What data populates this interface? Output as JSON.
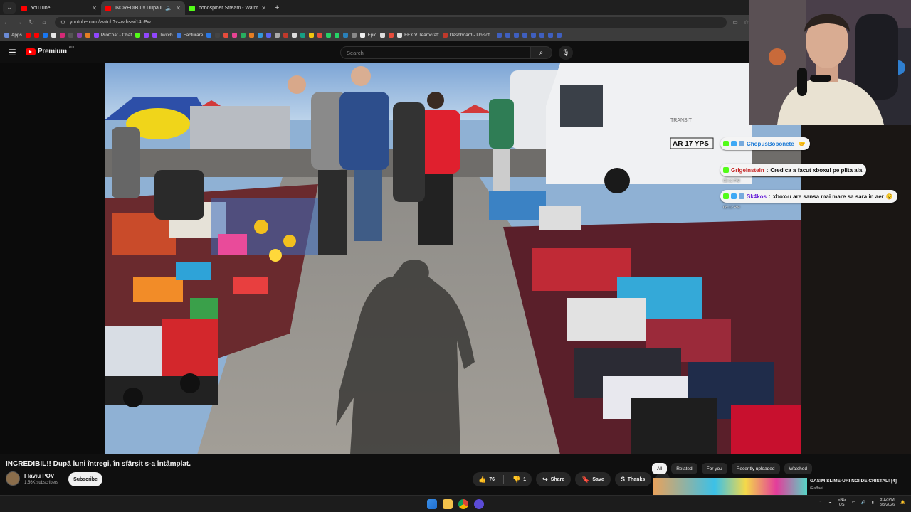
{
  "browser": {
    "tabs": [
      {
        "title": "YouTube",
        "favicon_color": "#ff0000",
        "active": false
      },
      {
        "title": "INCREDIBIL!! După luni întreg",
        "favicon_color": "#ff0000",
        "active": true
      },
      {
        "title": "bobospider Stream - Watch Liv",
        "favicon_color": "#53fc18",
        "active": false
      }
    ],
    "new_tab_icon": "+",
    "url": "youtube.com/watch?v=wthswi14cPw",
    "bookmarks": [
      "Apps",
      "ProChat - Chat",
      "Twitch",
      "Facturare",
      "Epic",
      "FFXIV Teamcraft",
      "Dashboard - Ubisof..."
    ]
  },
  "youtube": {
    "logo_text": "Premium",
    "country_code": "RO",
    "search_placeholder": "Search",
    "video_title": "INCREDIBIL!! După luni întregi, în sfârșit s-a întâmplat.",
    "channel_name": "Flaviu POV",
    "subscribers": "1.56K subscribers",
    "subscribe_label": "Subscribe",
    "likes": "76",
    "dislikes": "1",
    "share_label": "Share",
    "save_label": "Save",
    "thanks_label": "Thanks",
    "chips": [
      "All",
      "Related",
      "For you",
      "Recently uploaded",
      "Watched"
    ],
    "recommended": {
      "title": "GASIM SLIME-URI NOI DE CRISTAL! [4]",
      "channel": "iRaffaei"
    }
  },
  "chat": [
    {
      "user": "ChopusBobonete",
      "text": "",
      "time": "",
      "color": "#1e7bd6"
    },
    {
      "user": "Grigeinstein",
      "text": "Cred ca a facut xboxul pe plita aia",
      "time": "08:12 PM",
      "color": "#c62828"
    },
    {
      "user": "Sk4kos",
      "text": "xbox-u are sansa mai mare sa sara in aer",
      "time": "08:12 PM",
      "color": "#6d28d9"
    }
  ],
  "video_scene": {
    "van_plate": "AR 17 YPS",
    "van_brand": "TRANSIT"
  },
  "taskbar": {
    "lang_top": "ENG",
    "lang_bottom": "US",
    "time": "8:12 PM",
    "date": "8/5/2026"
  }
}
